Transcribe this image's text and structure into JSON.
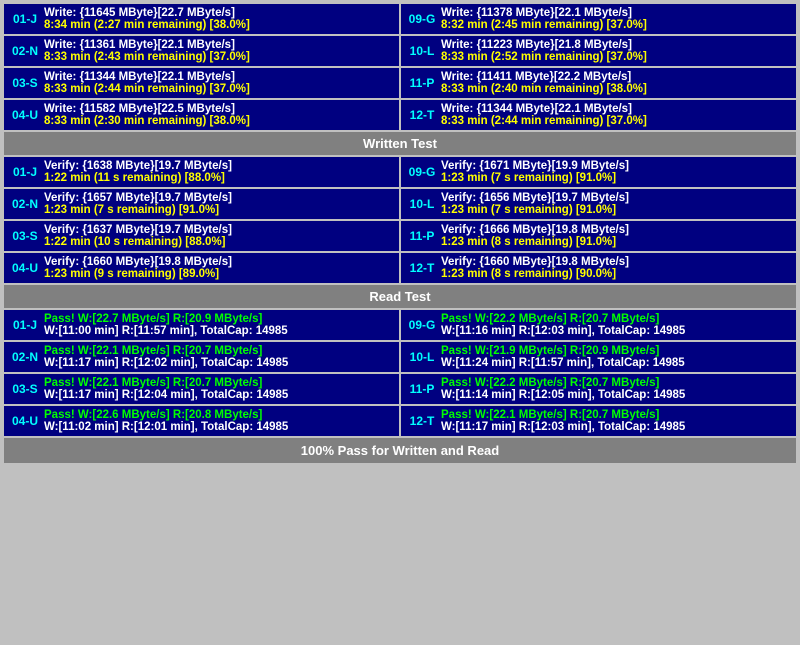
{
  "sections": {
    "write": {
      "label": "Written Test",
      "cards_left": [
        {
          "id": "01-J",
          "line1": "Write: {11645 MByte}[22.7 MByte/s]",
          "line2": "8:34 min (2:27 min remaining)  [38.0%]"
        },
        {
          "id": "02-N",
          "line1": "Write: {11361 MByte}[22.1 MByte/s]",
          "line2": "8:33 min (2:43 min remaining)  [37.0%]"
        },
        {
          "id": "03-S",
          "line1": "Write: {11344 MByte}[22.1 MByte/s]",
          "line2": "8:33 min (2:44 min remaining)  [37.0%]"
        },
        {
          "id": "04-U",
          "line1": "Write: {11582 MByte}[22.5 MByte/s]",
          "line2": "8:33 min (2:30 min remaining)  [38.0%]"
        }
      ],
      "cards_right": [
        {
          "id": "09-G",
          "line1": "Write: {11378 MByte}[22.1 MByte/s]",
          "line2": "8:32 min (2:45 min remaining)  [37.0%]"
        },
        {
          "id": "10-L",
          "line1": "Write: {11223 MByte}[21.8 MByte/s]",
          "line2": "8:33 min (2:52 min remaining)  [37.0%]"
        },
        {
          "id": "11-P",
          "line1": "Write: {11411 MByte}[22.2 MByte/s]",
          "line2": "8:33 min (2:40 min remaining)  [38.0%]"
        },
        {
          "id": "12-T",
          "line1": "Write: {11344 MByte}[22.1 MByte/s]",
          "line2": "8:33 min (2:44 min remaining)  [37.0%]"
        }
      ]
    },
    "verify": {
      "label": "Written Test",
      "cards_left": [
        {
          "id": "01-J",
          "line1": "Verify: {1638 MByte}[19.7 MByte/s]",
          "line2": "1:22 min (11 s remaining)   [88.0%]"
        },
        {
          "id": "02-N",
          "line1": "Verify: {1657 MByte}[19.7 MByte/s]",
          "line2": "1:23 min (7 s remaining)   [91.0%]"
        },
        {
          "id": "03-S",
          "line1": "Verify: {1637 MByte}[19.7 MByte/s]",
          "line2": "1:22 min (10 s remaining)   [88.0%]"
        },
        {
          "id": "04-U",
          "line1": "Verify: {1660 MByte}[19.8 MByte/s]",
          "line2": "1:23 min (9 s remaining)   [89.0%]"
        }
      ],
      "cards_right": [
        {
          "id": "09-G",
          "line1": "Verify: {1671 MByte}[19.9 MByte/s]",
          "line2": "1:23 min (7 s remaining)   [91.0%]"
        },
        {
          "id": "10-L",
          "line1": "Verify: {1656 MByte}[19.7 MByte/s]",
          "line2": "1:23 min (7 s remaining)   [91.0%]"
        },
        {
          "id": "11-P",
          "line1": "Verify: {1666 MByte}[19.8 MByte/s]",
          "line2": "1:23 min (8 s remaining)   [91.0%]"
        },
        {
          "id": "12-T",
          "line1": "Verify: {1660 MByte}[19.8 MByte/s]",
          "line2": "1:23 min (8 s remaining)   [90.0%]"
        }
      ]
    },
    "read": {
      "label": "Read Test",
      "cards_left": [
        {
          "id": "01-J",
          "line1": "Pass! W:[22.7 MByte/s] R:[20.9 MByte/s]",
          "line2": "W:[11:00 min] R:[11:57 min], TotalCap: 14985"
        },
        {
          "id": "02-N",
          "line1": "Pass! W:[22.1 MByte/s] R:[20.7 MByte/s]",
          "line2": "W:[11:17 min] R:[12:02 min], TotalCap: 14985"
        },
        {
          "id": "03-S",
          "line1": "Pass! W:[22.1 MByte/s] R:[20.7 MByte/s]",
          "line2": "W:[11:17 min] R:[12:04 min], TotalCap: 14985"
        },
        {
          "id": "04-U",
          "line1": "Pass! W:[22.6 MByte/s] R:[20.8 MByte/s]",
          "line2": "W:[11:02 min] R:[12:01 min], TotalCap: 14985"
        }
      ],
      "cards_right": [
        {
          "id": "09-G",
          "line1": "Pass! W:[22.2 MByte/s] R:[20.7 MByte/s]",
          "line2": "W:[11:16 min] R:[12:03 min], TotalCap: 14985"
        },
        {
          "id": "10-L",
          "line1": "Pass! W:[21.9 MByte/s] R:[20.9 MByte/s]",
          "line2": "W:[11:24 min] R:[11:57 min], TotalCap: 14985"
        },
        {
          "id": "11-P",
          "line1": "Pass! W:[22.2 MByte/s] R:[20.7 MByte/s]",
          "line2": "W:[11:14 min] R:[12:05 min], TotalCap: 14985"
        },
        {
          "id": "12-T",
          "line1": "Pass! W:[22.1 MByte/s] R:[20.7 MByte/s]",
          "line2": "W:[11:17 min] R:[12:03 min], TotalCap: 14985"
        }
      ]
    }
  },
  "labels": {
    "written_test": "Written Test",
    "read_test": "Read Test",
    "footer": "100% Pass for Written and Read"
  }
}
